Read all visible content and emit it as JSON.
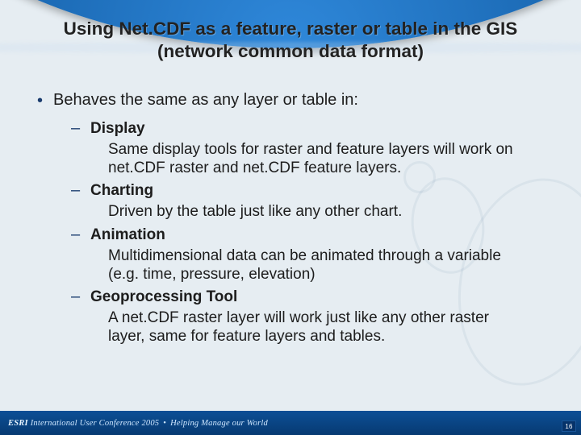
{
  "title": {
    "line1": "Using Net.CDF as a feature, raster or table in the GIS",
    "line2": "(network common data format)"
  },
  "bullet_main": "Behaves the same as any layer or table in:",
  "sub_bullets": [
    {
      "label": "Display",
      "body": "Same display tools for raster and feature layers will work on net.CDF raster and net.CDF feature layers."
    },
    {
      "label": "Charting",
      "body": "Driven by the table just like any other chart."
    },
    {
      "label": "Animation",
      "body": "Multidimensional data can be animated through a variable (e.g. time, pressure, elevation)"
    },
    {
      "label": "Geoprocessing Tool",
      "body": "A net.CDF raster layer will work just like any other raster layer, same for feature layers and tables."
    }
  ],
  "footer": {
    "brand": "ESRI",
    "text": "International User Conference 2005",
    "tagline": "Helping Manage our World",
    "page": "16"
  }
}
